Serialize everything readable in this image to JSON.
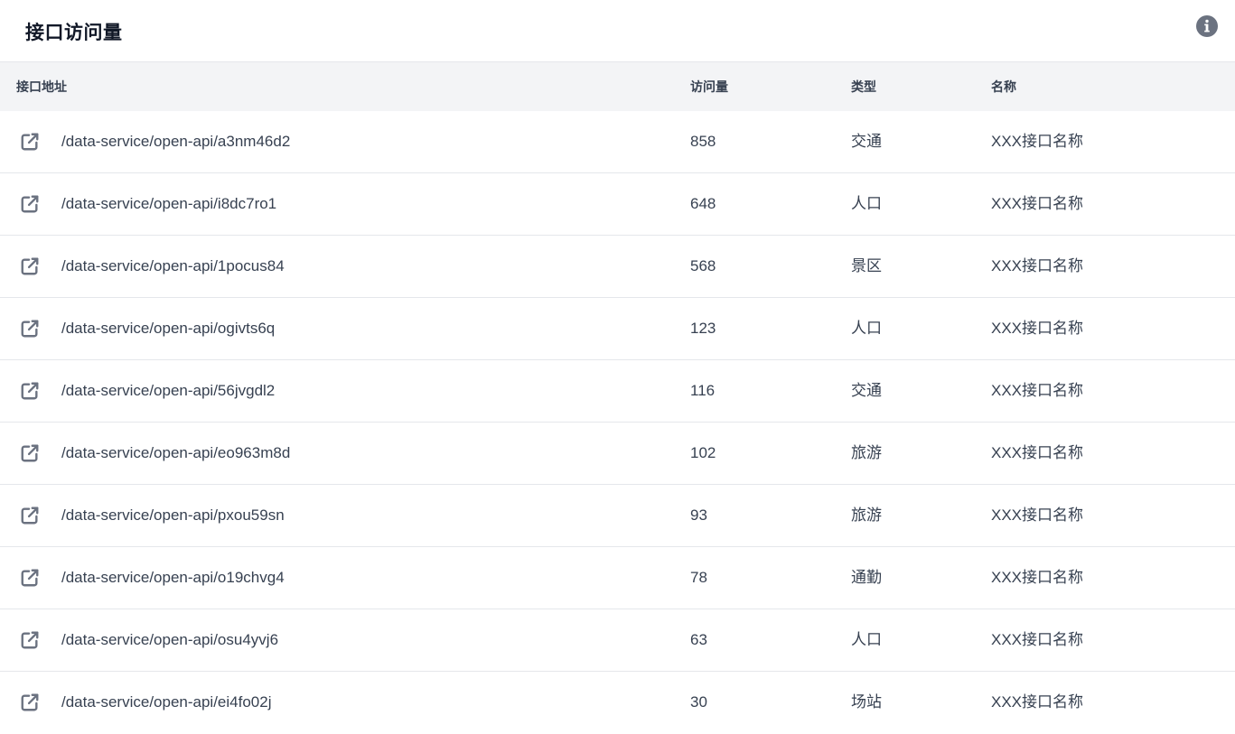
{
  "header": {
    "title": "接口访问量",
    "info_icon": "info-circle-icon"
  },
  "table": {
    "columns": {
      "address": "接口地址",
      "count": "访问量",
      "type": "类型",
      "name": "名称"
    },
    "rows": [
      {
        "address": "/data-service/open-api/a3nm46d2",
        "count": "858",
        "type": "交通",
        "name": "XXX接口名称"
      },
      {
        "address": "/data-service/open-api/i8dc7ro1",
        "count": "648",
        "type": "人口",
        "name": "XXX接口名称"
      },
      {
        "address": "/data-service/open-api/1pocus84",
        "count": "568",
        "type": "景区",
        "name": "XXX接口名称"
      },
      {
        "address": "/data-service/open-api/ogivts6q",
        "count": "123",
        "type": "人口",
        "name": "XXX接口名称"
      },
      {
        "address": "/data-service/open-api/56jvgdl2",
        "count": "116",
        "type": "交通",
        "name": "XXX接口名称"
      },
      {
        "address": "/data-service/open-api/eo963m8d",
        "count": "102",
        "type": "旅游",
        "name": "XXX接口名称"
      },
      {
        "address": "/data-service/open-api/pxou59sn",
        "count": "93",
        "type": "旅游",
        "name": "XXX接口名称"
      },
      {
        "address": "/data-service/open-api/o19chvg4",
        "count": "78",
        "type": "通勤",
        "name": "XXX接口名称"
      },
      {
        "address": "/data-service/open-api/osu4yvj6",
        "count": "63",
        "type": "人口",
        "name": "XXX接口名称"
      },
      {
        "address": "/data-service/open-api/ei4fo02j",
        "count": "30",
        "type": "场站",
        "name": "XXX接口名称"
      }
    ],
    "row_icon": "external-link-icon"
  },
  "colors": {
    "header_bg": "#f3f4f6",
    "icon": "#6b7280",
    "border": "#e5e7eb"
  }
}
